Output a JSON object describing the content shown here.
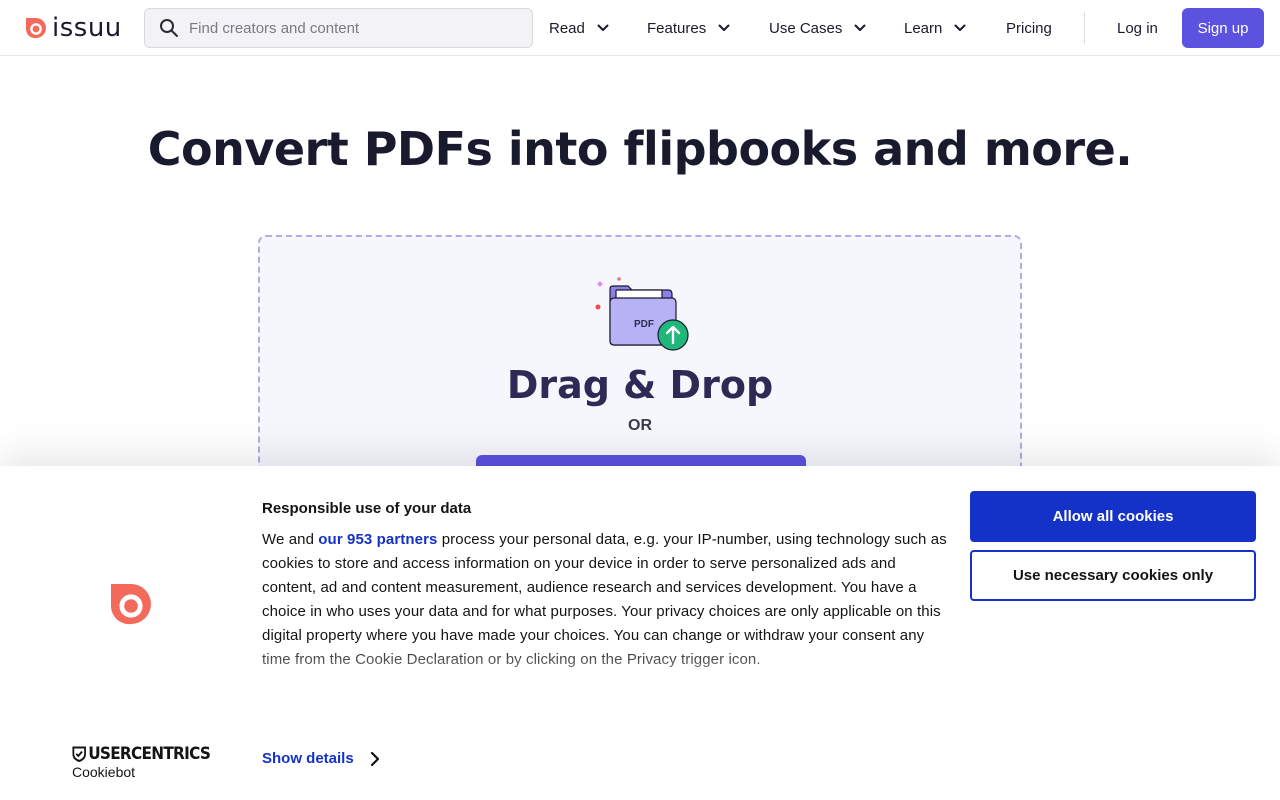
{
  "header": {
    "logo_text": "issuu",
    "search_placeholder": "Find creators and content",
    "nav": [
      {
        "label": "Read"
      },
      {
        "label": "Features"
      },
      {
        "label": "Use Cases"
      },
      {
        "label": "Learn"
      },
      {
        "label": "Pricing"
      }
    ],
    "login_label": "Log in",
    "signup_label": "Sign up"
  },
  "hero": {
    "title": "Convert PDFs into flipbooks and more.",
    "drop_title": "Drag & Drop",
    "or_label": "OR",
    "folder_label": "PDF"
  },
  "cookie": {
    "title": "Responsible use of your data",
    "text_before": "We and ",
    "partners_link": "our 953 partners",
    "text_after": " process your personal data, e.g. your IP-number, using technology such as cookies to store and access information on your device in order to serve personalized ads and content, ad and content measurement, audience research and services development. You have a choice in who uses your data and for what purposes. Your privacy choices are only applicable on this digital property where you have made your choices. You can change or withdraw your consent any time from the Cookie Declaration or by clicking on the Privacy trigger icon.",
    "allow_all_label": "Allow all cookies",
    "necessary_label": "Use necessary cookies only",
    "show_details_label": "Show details",
    "brand_top": "USERCENTRICS",
    "brand_bottom": "Cookiebot"
  },
  "colors": {
    "brand_red": "#f36a5a",
    "accent_purple": "#5b52e0",
    "cookie_blue": "#1532c8"
  }
}
